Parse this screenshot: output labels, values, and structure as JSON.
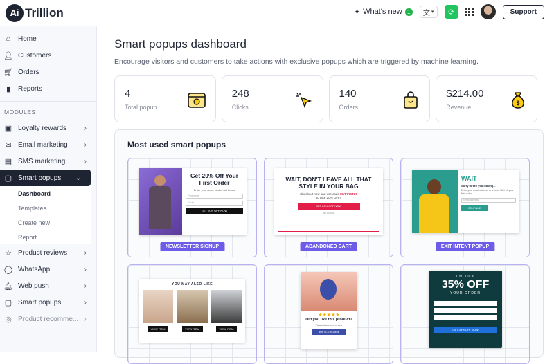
{
  "header": {
    "logo_mark": "Ai",
    "logo_text": "Trillion",
    "whats_new": "What's new",
    "whats_new_count": "1",
    "support": "Support"
  },
  "sidebar": {
    "top_items": [
      {
        "label": "Home",
        "icon": "home-icon"
      },
      {
        "label": "Customers",
        "icon": "user-icon"
      },
      {
        "label": "Orders",
        "icon": "cart-icon"
      },
      {
        "label": "Reports",
        "icon": "bar-chart-icon"
      }
    ],
    "modules_heading": "MODULES",
    "modules": [
      {
        "label": "Loyalty rewards",
        "icon": "gift-icon"
      },
      {
        "label": "Email marketing",
        "icon": "mail-icon"
      },
      {
        "label": "SMS marketing",
        "icon": "chat-icon"
      },
      {
        "label": "Smart popups",
        "icon": "popup-icon"
      },
      {
        "label": "Product reviews",
        "icon": "star-icon"
      },
      {
        "label": "WhatsApp",
        "icon": "whatsapp-icon"
      },
      {
        "label": "Web push",
        "icon": "bell-icon"
      },
      {
        "label": "Smart popups",
        "icon": "popup-icon"
      },
      {
        "label": "Product recomme...",
        "icon": "recommend-icon"
      }
    ],
    "submenu": [
      "Dashboard",
      "Templates",
      "Create new",
      "Report"
    ]
  },
  "main": {
    "title": "Smart popups dashboard",
    "description": "Encourage visitors and customers to take actions with exclusive popups which are triggered by machine learning.",
    "stats": [
      {
        "value": "4",
        "label": "Total popup",
        "icon": "browser-window-icon"
      },
      {
        "value": "248",
        "label": "Clicks",
        "icon": "cursor-click-icon"
      },
      {
        "value": "140",
        "label": "Orders",
        "icon": "shopping-bag-icon"
      },
      {
        "value": "$214.00",
        "label": "Revenue",
        "icon": "money-bag-icon"
      }
    ],
    "panel_title": "Most used smart popups",
    "popups": {
      "newsletter": {
        "headline": "Get 20% Off Your First Order",
        "sub": "Enter your name and email below",
        "field1": "First name",
        "field2": "Email",
        "button": "GET 20% OFF NOW",
        "tag": "NEWSLETTER SIGNUP"
      },
      "cart": {
        "headline": "WAIT, DON'T LEAVE ALL THAT STYLE IN YOUR BAG",
        "line1": "Checkout now and use code",
        "code": "MYFIRST20",
        "line2": "to take 20% OFF!",
        "button": "GET 20% OFF NOW",
        "dismiss": "No thanks",
        "tag": "ABANDONED CART"
      },
      "exit": {
        "headline": "WAIT",
        "sub": "Sorry to see you leaving...",
        "body": "Enter your email address to receive 10% off your first order",
        "field": "Email address",
        "button": "CONTINUE",
        "tag": "EXIT INTENT POPUP"
      },
      "also_like": {
        "headline": "YOU MAY ALSO LIKE",
        "button": "VIEW ITEM"
      },
      "review": {
        "stars": "★★★★★",
        "headline": "Did you like this product?",
        "sub": "Please leave us a review",
        "button": "WRITE A REVIEW"
      },
      "unlock": {
        "line1": "UNLOCK",
        "big": "35% OFF",
        "line3": "YOUR ORDER",
        "button": "GET 35% OFF NOW"
      }
    }
  }
}
